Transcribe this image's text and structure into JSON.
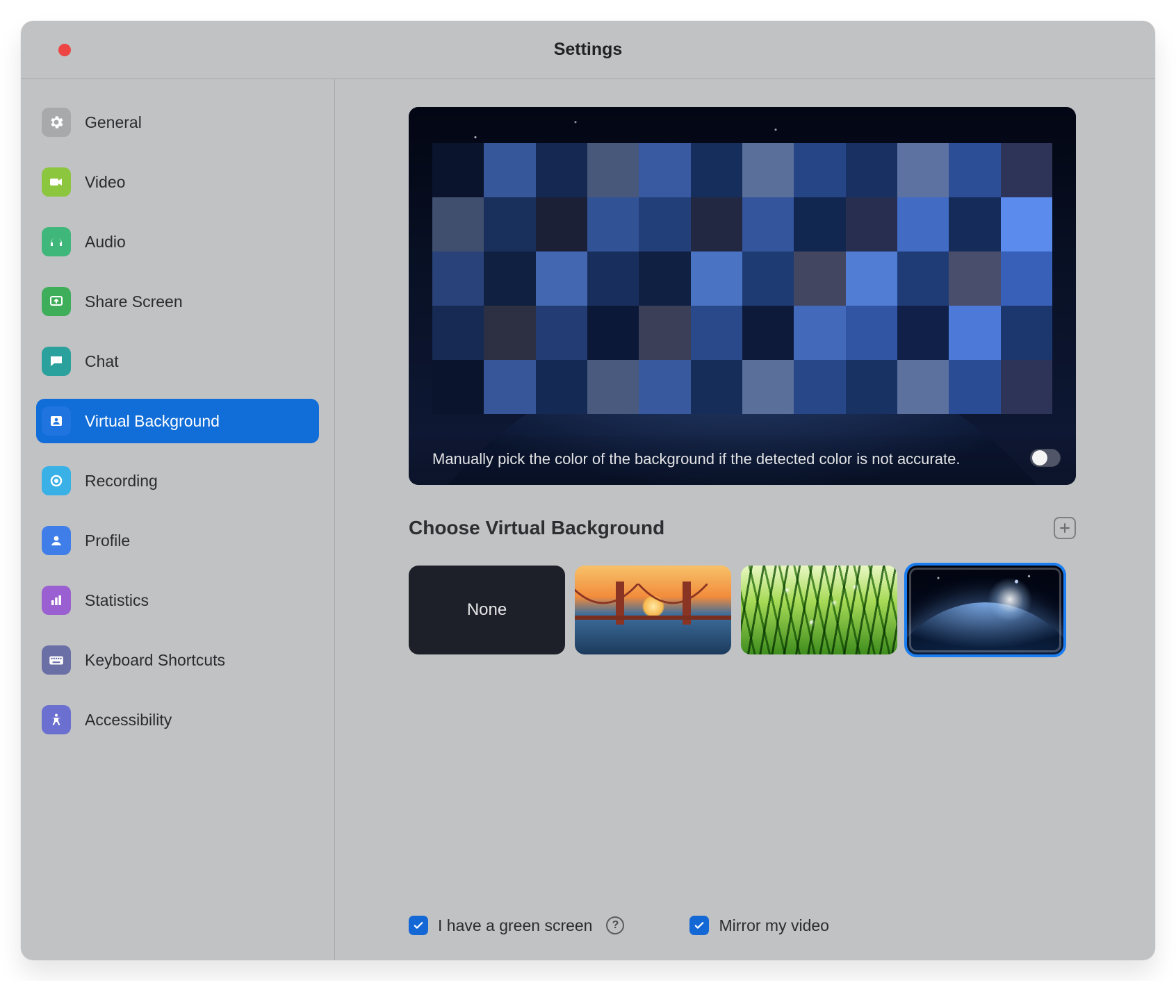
{
  "window": {
    "title": "Settings"
  },
  "sidebar": {
    "items": [
      {
        "label": "General",
        "icon": "gear-icon",
        "color": "#a7a9ab"
      },
      {
        "label": "Video",
        "icon": "video-icon",
        "color": "#8cc63f"
      },
      {
        "label": "Audio",
        "icon": "audio-icon",
        "color": "#3fb77a"
      },
      {
        "label": "Share Screen",
        "icon": "share-icon",
        "color": "#3fae5a"
      },
      {
        "label": "Chat",
        "icon": "chat-icon",
        "color": "#2aa19c"
      },
      {
        "label": "Virtual Background",
        "icon": "vb-icon",
        "color": "#1f74e0",
        "selected": true
      },
      {
        "label": "Recording",
        "icon": "record-icon",
        "color": "#39b0e6"
      },
      {
        "label": "Profile",
        "icon": "profile-icon",
        "color": "#3f7ee8"
      },
      {
        "label": "Statistics",
        "icon": "stats-icon",
        "color": "#9a5fd0"
      },
      {
        "label": "Keyboard Shortcuts",
        "icon": "keyboard-icon",
        "color": "#6a6fa6"
      },
      {
        "label": "Accessibility",
        "icon": "a11y-icon",
        "color": "#6b6fcf"
      }
    ]
  },
  "preview": {
    "hint": "Manually pick the color of the background if the detected color is not accurate.",
    "toggle_on": false
  },
  "choose": {
    "title": "Choose Virtual Background",
    "add_tooltip": "Add Image",
    "thumbs": [
      {
        "kind": "none",
        "label": "None",
        "selected": false
      },
      {
        "kind": "bridge",
        "label": "Golden Gate Bridge",
        "selected": false
      },
      {
        "kind": "grass",
        "label": "Grass",
        "selected": false
      },
      {
        "kind": "earth",
        "label": "Earth from space",
        "selected": true
      }
    ]
  },
  "footer": {
    "green_screen": {
      "label": "I have a green screen",
      "checked": true
    },
    "mirror": {
      "label": "Mirror my video",
      "checked": true
    }
  },
  "callout": {
    "target": "add-background-button"
  }
}
